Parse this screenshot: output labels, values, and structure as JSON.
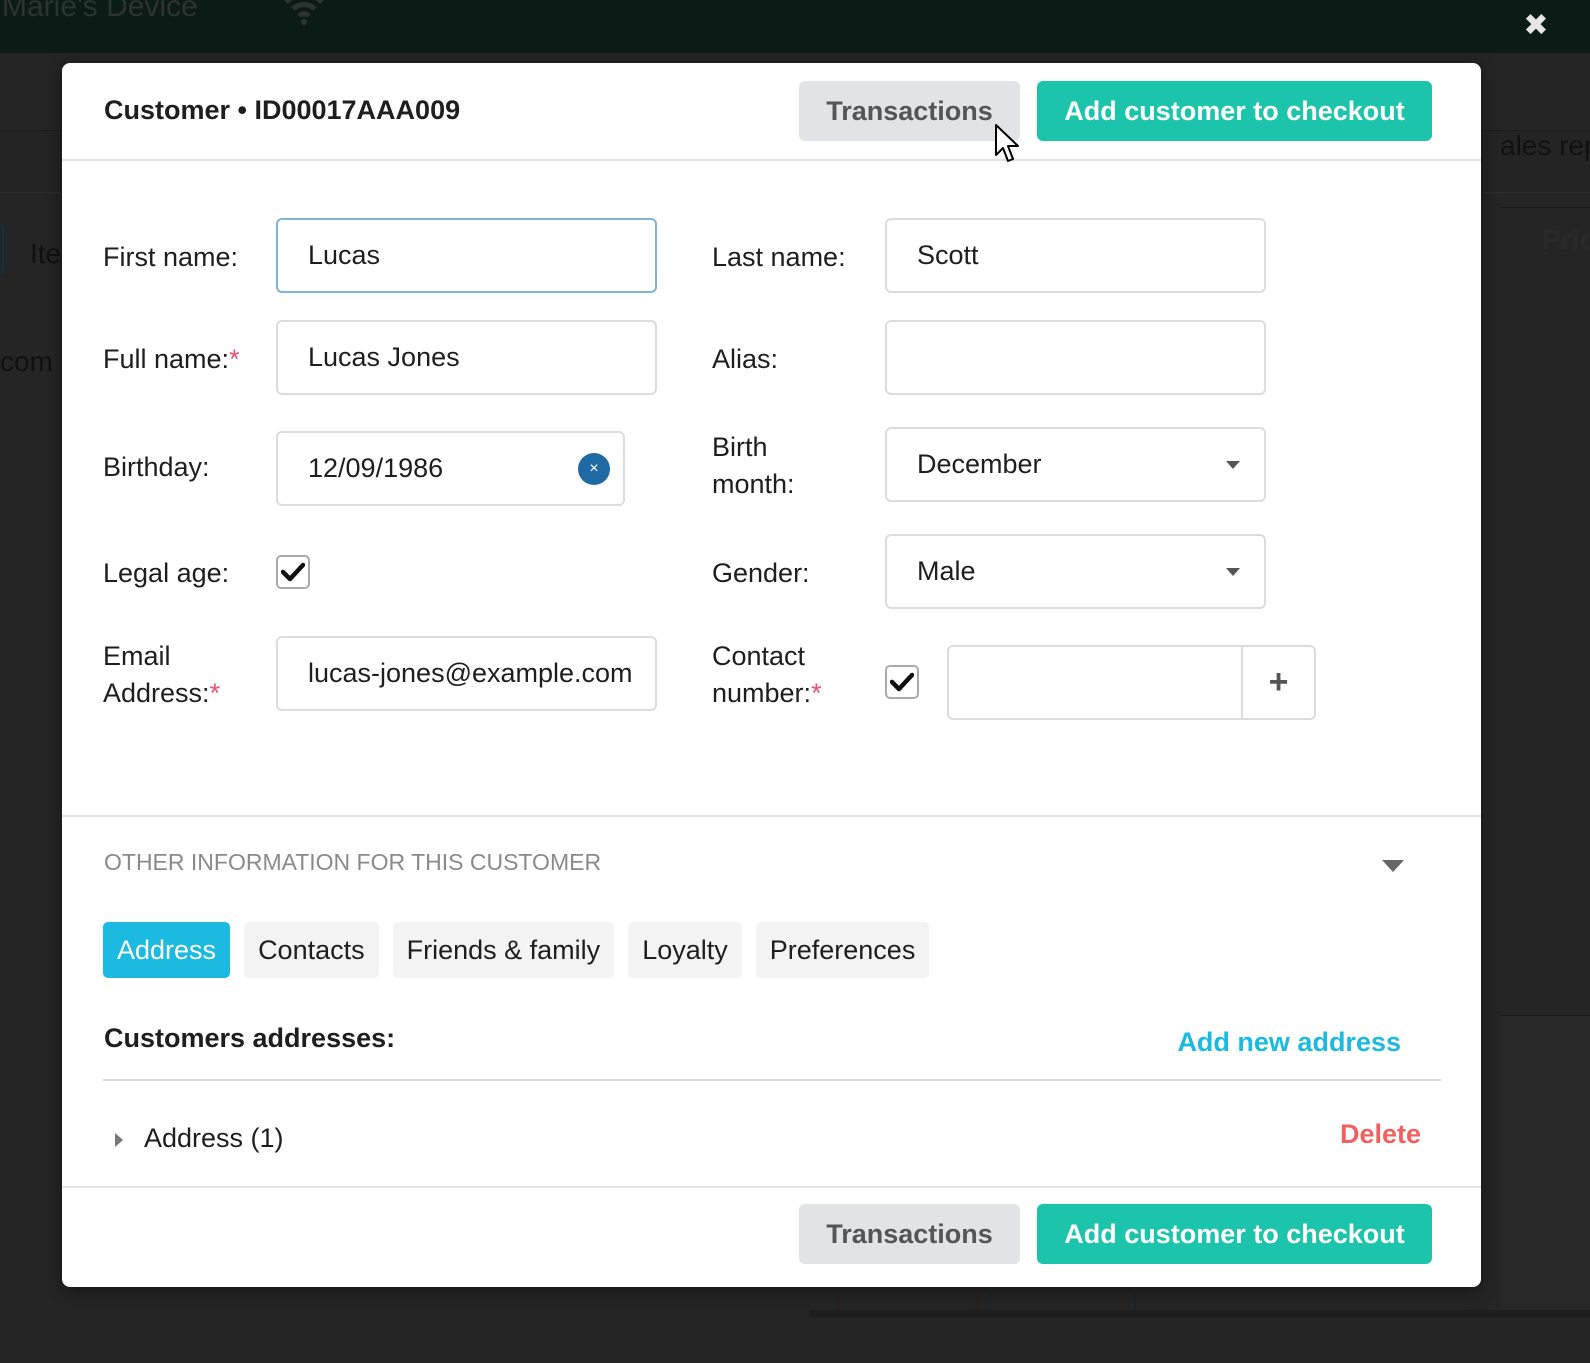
{
  "background": {
    "device_name": "Marie's Device",
    "wifi_icon": "wifi-icon",
    "close_icon": "close-icon",
    "partial_text_item": "Ite",
    "partial_text_com": "com",
    "partial_text_sales": "ales rep",
    "partial_text_price": "Pric"
  },
  "modal": {
    "title": "Customer • ID00017AAA009",
    "header_buttons": {
      "transactions": "Transactions",
      "add_to_checkout": "Add customer to checkout"
    },
    "form": {
      "first_name": {
        "label": "First name:",
        "value": "Lucas"
      },
      "last_name": {
        "label": "Last name:",
        "value": "Scott"
      },
      "full_name": {
        "label": "Full name:",
        "required_mark": "*",
        "value": "Lucas Jones"
      },
      "alias": {
        "label": "Alias:",
        "value": ""
      },
      "birthday": {
        "label": "Birthday:",
        "value": "12/09/1986",
        "clear_icon": "×"
      },
      "birth_month": {
        "label_line1": "Birth",
        "label_line2": "month:",
        "value": "December"
      },
      "legal_age": {
        "label": "Legal age:",
        "checked": true
      },
      "gender": {
        "label": "Gender:",
        "value": "Male"
      },
      "email": {
        "label_line1": "Email",
        "label_line2": "Address:",
        "required_mark": "*",
        "value": "lucas-jones@example.com"
      },
      "contact_number": {
        "label_line1": "Contact",
        "label_line2": "number:",
        "required_mark": "*",
        "checked": true,
        "value": "",
        "add_icon": "+"
      }
    },
    "other_info": {
      "title": "OTHER INFORMATION FOR THIS CUSTOMER",
      "tabs": [
        {
          "label": "Address",
          "active": true
        },
        {
          "label": "Contacts",
          "active": false
        },
        {
          "label": "Friends & family",
          "active": false
        },
        {
          "label": "Loyalty",
          "active": false
        },
        {
          "label": "Preferences",
          "active": false
        }
      ],
      "addresses_heading": "Customers addresses:",
      "add_new_address": "Add new address",
      "addresses": [
        {
          "name": "Address (1)",
          "delete_label": "Delete"
        }
      ]
    },
    "footer_buttons": {
      "transactions": "Transactions",
      "add_to_checkout": "Add customer to checkout"
    }
  },
  "colors": {
    "teal_primary": "#1cc4ab",
    "tab_active": "#1cb9e0",
    "link": "#1cb9e0",
    "delete": "#ee6160",
    "required": "#f0506e",
    "clear_button": "#1f6aa5"
  }
}
